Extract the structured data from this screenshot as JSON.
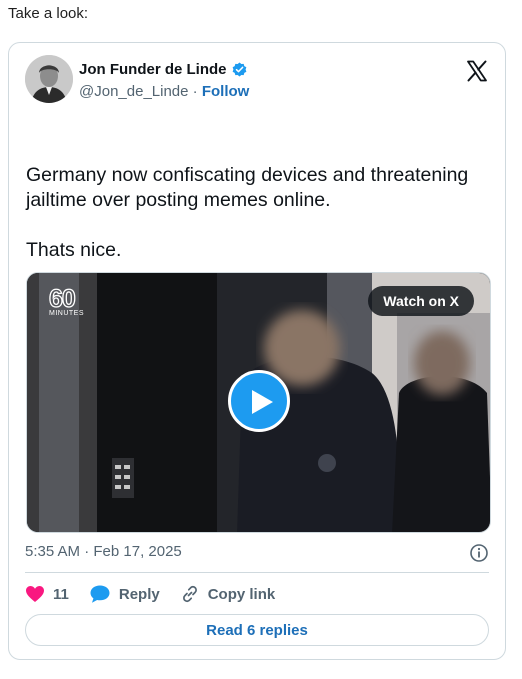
{
  "intro_text": "Take a look:",
  "author": {
    "name": "Jon Funder de Linde",
    "handle": "@Jon_de_Linde",
    "separator": "·",
    "follow_label": "Follow"
  },
  "tweet": {
    "paragraphs": [
      "Germany now confiscating devices and threatening jailtime over posting memes online.",
      "Thats nice."
    ]
  },
  "media": {
    "logo_number": "60",
    "logo_text": "MINUTES",
    "watch_label": "Watch on X"
  },
  "timestamp": "5:35 AM · Feb 17, 2025",
  "actions": {
    "like_count": "11",
    "reply_label": "Reply",
    "copy_link_label": "Copy link"
  },
  "read_replies_label": "Read 6 replies",
  "colors": {
    "accent": "#1d9bf0",
    "like": "#f91880",
    "link": "#1d6fb8",
    "muted": "#536471"
  },
  "icons": [
    "verified-badge-icon",
    "x-logo-icon",
    "play-icon",
    "info-icon",
    "heart-icon",
    "reply-bubble-icon",
    "link-icon"
  ]
}
